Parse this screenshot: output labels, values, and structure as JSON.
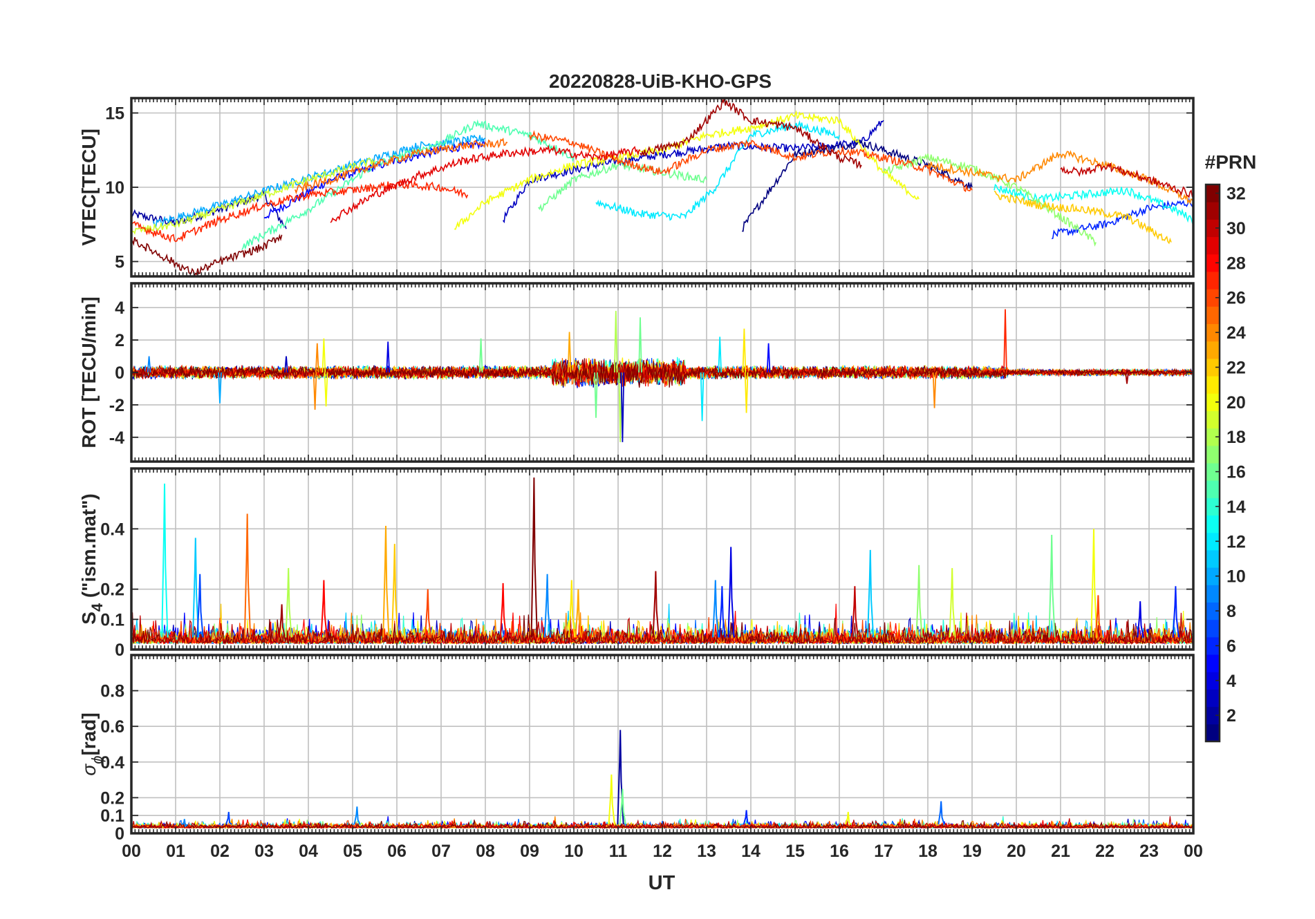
{
  "figure": {
    "title": "20220828-UiB-KHO-GPS"
  },
  "colorbar": {
    "label": "#PRN",
    "colormap": "jet",
    "range": [
      1,
      32
    ],
    "ticks": [
      "2",
      "4",
      "6",
      "8",
      "10",
      "12",
      "14",
      "16",
      "18",
      "20",
      "22",
      "24",
      "26",
      "28",
      "30",
      "32"
    ]
  },
  "colors": {
    "axis": "#262626",
    "grid": "#c0c0c0",
    "background": "#ffffff"
  },
  "chart_data": [
    {
      "type": "line",
      "panel": "vtec",
      "ylabel": "VTEC[TECU]",
      "ylabel_sub": "",
      "ylim": [
        4,
        16
      ],
      "yticks": [
        "5",
        "10",
        "15"
      ],
      "ytick_values": [
        5,
        10,
        15
      ],
      "xlim": [
        0,
        24
      ],
      "grid": true,
      "series": [
        {
          "prn": 2,
          "x": [
            0.0,
            1.0,
            2.0,
            3.0,
            3.5
          ],
          "y": [
            8.2,
            7.6,
            8.5,
            9.5,
            7.2
          ]
        },
        {
          "prn": 5,
          "x": [
            3.0,
            4.5,
            6.0,
            7.0,
            8.0
          ],
          "y": [
            8.0,
            10.5,
            11.8,
            12.5,
            13.0
          ]
        },
        {
          "prn": 3,
          "x": [
            8.4,
            9.0,
            10.5,
            12.0,
            13.5,
            15.0,
            16.5,
            17.0
          ],
          "y": [
            7.8,
            10.5,
            11.5,
            12.2,
            12.8,
            12.6,
            13.0,
            14.5
          ]
        },
        {
          "prn": 1,
          "x": [
            13.8,
            15.0,
            16.5,
            18.0,
            19.0
          ],
          "y": [
            7.2,
            12.2,
            13.0,
            11.5,
            10.0
          ]
        },
        {
          "prn": 6,
          "x": [
            20.8,
            22.0,
            23.0,
            24.0
          ],
          "y": [
            6.8,
            7.5,
            8.6,
            9.0
          ]
        },
        {
          "prn": 10,
          "x": [
            0.5,
            2.0,
            3.5,
            5.0,
            6.5,
            8.0
          ],
          "y": [
            7.5,
            8.8,
            10.2,
            11.5,
            12.8,
            13.3
          ]
        },
        {
          "prn": 12,
          "x": [
            10.5,
            11.5,
            12.5,
            13.2,
            14.0,
            15.0,
            16.0
          ],
          "y": [
            9.0,
            8.2,
            8.0,
            10.0,
            13.5,
            14.2,
            13.5
          ]
        },
        {
          "prn": 13,
          "x": [
            19.5,
            20.5,
            21.5,
            22.5,
            23.5,
            24.0
          ],
          "y": [
            10.0,
            9.2,
            9.5,
            9.8,
            8.6,
            7.8
          ]
        },
        {
          "prn": 15,
          "x": [
            2.5,
            4.0,
            5.5,
            7.0,
            7.8,
            9.0,
            10.0
          ],
          "y": [
            6.0,
            8.5,
            11.5,
            13.0,
            14.3,
            13.5,
            12.0
          ]
        },
        {
          "prn": 16,
          "x": [
            9.2,
            10.0,
            11.0,
            12.0,
            13.0
          ],
          "y": [
            8.5,
            10.5,
            11.5,
            11.0,
            10.5
          ]
        },
        {
          "prn": 17,
          "x": [
            17.0,
            18.0,
            19.0,
            20.0,
            21.0,
            21.8
          ],
          "y": [
            11.0,
            12.0,
            11.3,
            10.0,
            8.0,
            6.3
          ]
        },
        {
          "prn": 19,
          "x": [
            0.0,
            1.0,
            2.0,
            3.0,
            4.0,
            5.5
          ],
          "y": [
            7.0,
            7.5,
            8.5,
            9.5,
            10.5,
            11.8
          ]
        },
        {
          "prn": 20,
          "x": [
            7.3,
            8.0,
            9.0,
            10.0,
            11.0,
            12.0,
            13.0,
            14.0,
            15.0,
            16.0,
            17.0,
            17.8
          ],
          "y": [
            7.2,
            9.0,
            10.5,
            11.5,
            12.0,
            12.5,
            13.5,
            14.0,
            14.8,
            14.5,
            11.0,
            9.2
          ]
        },
        {
          "prn": 22,
          "x": [
            19.5,
            20.5,
            21.5,
            22.5,
            23.5
          ],
          "y": [
            9.5,
            8.8,
            8.5,
            8.0,
            6.3
          ]
        },
        {
          "prn": 24,
          "x": [
            18.0,
            19.0,
            20.0,
            21.0,
            22.0,
            23.0,
            24.0
          ],
          "y": [
            11.5,
            11.0,
            10.5,
            12.3,
            11.5,
            10.5,
            9.0
          ]
        },
        {
          "prn": 25,
          "x": [
            3.7,
            4.5,
            5.5,
            6.5,
            7.5,
            8.5
          ],
          "y": [
            9.8,
            10.5,
            11.5,
            12.3,
            12.8,
            13.0
          ]
        },
        {
          "prn": 26,
          "x": [
            9.0,
            10.0,
            11.0,
            12.0,
            13.0,
            14.0,
            15.0,
            16.0,
            17.0,
            18.0,
            19.0
          ],
          "y": [
            13.5,
            13.0,
            11.8,
            11.0,
            12.5,
            13.0,
            12.0,
            12.5,
            12.0,
            11.2,
            9.8
          ]
        },
        {
          "prn": 27,
          "x": [
            0.0,
            1.0,
            2.0,
            3.0,
            4.0,
            5.0,
            6.0,
            7.0,
            7.6
          ],
          "y": [
            7.5,
            6.5,
            7.8,
            8.8,
            9.5,
            9.8,
            10.2,
            10.0,
            9.5
          ]
        },
        {
          "prn": 29,
          "x": [
            4.5,
            5.5,
            6.5,
            7.5,
            8.5,
            9.5,
            10.5,
            11.5
          ],
          "y": [
            7.8,
            9.5,
            10.8,
            11.8,
            12.3,
            12.5,
            12.0,
            12.5
          ]
        },
        {
          "prn": 31,
          "x": [
            11.5,
            12.5,
            13.0,
            13.4,
            14.0,
            15.0,
            16.0,
            16.5
          ],
          "y": [
            12.3,
            13.0,
            14.5,
            15.8,
            14.5,
            14.0,
            12.0,
            11.5
          ]
        },
        {
          "prn": 32,
          "x": [
            0.0,
            0.8,
            1.4,
            2.0,
            3.0,
            3.4
          ],
          "y": [
            6.5,
            5.2,
            4.2,
            5.0,
            6.0,
            6.8
          ]
        },
        {
          "prn": 30,
          "x": [
            21.0,
            21.5,
            22.0,
            22.5,
            23.0,
            23.5,
            24.0
          ],
          "y": [
            11.2,
            11.0,
            11.5,
            11.0,
            10.5,
            10.0,
            9.5
          ]
        }
      ]
    },
    {
      "type": "line",
      "panel": "rot",
      "ylabel": "ROT [TECU/min]",
      "ylabel_sub": "",
      "ylim": [
        -5.5,
        5.5
      ],
      "yticks": [
        "-4",
        "-2",
        "0",
        "2",
        "4"
      ],
      "ytick_values": [
        -4,
        -2,
        0,
        2,
        4
      ],
      "xlim": [
        0,
        24
      ],
      "grid": true,
      "noise_level_TECU_per_min": 0.3,
      "spikes": [
        {
          "x": 0.4,
          "y": 1.0,
          "prn": 9
        },
        {
          "x": 2.0,
          "y": -1.9,
          "prn": 10
        },
        {
          "x": 3.5,
          "y": 1.0,
          "prn": 3
        },
        {
          "x": 4.15,
          "y": -2.3,
          "prn": 24
        },
        {
          "x": 4.2,
          "y": 1.8,
          "prn": 24
        },
        {
          "x": 4.4,
          "y": -2.1,
          "prn": 20
        },
        {
          "x": 4.35,
          "y": 2.1,
          "prn": 20
        },
        {
          "x": 5.8,
          "y": 1.9,
          "prn": 4
        },
        {
          "x": 7.9,
          "y": 2.1,
          "prn": 16
        },
        {
          "x": 9.9,
          "y": 2.5,
          "prn": 23
        },
        {
          "x": 10.5,
          "y": -2.8,
          "prn": 16
        },
        {
          "x": 10.95,
          "y": 3.8,
          "prn": 18
        },
        {
          "x": 11.05,
          "y": -4.3,
          "prn": 18
        },
        {
          "x": 11.1,
          "y": -4.3,
          "prn": 3
        },
        {
          "x": 11.5,
          "y": 3.4,
          "prn": 16
        },
        {
          "x": 13.3,
          "y": 2.2,
          "prn": 12
        },
        {
          "x": 12.9,
          "y": -3.0,
          "prn": 12
        },
        {
          "x": 13.85,
          "y": 2.7,
          "prn": 21
        },
        {
          "x": 13.9,
          "y": -2.5,
          "prn": 21
        },
        {
          "x": 14.4,
          "y": 1.8,
          "prn": 5
        },
        {
          "x": 18.15,
          "y": -2.2,
          "prn": 24
        },
        {
          "x": 19.75,
          "y": 3.9,
          "prn": 27
        },
        {
          "x": 22.5,
          "y": -0.7,
          "prn": 31
        }
      ]
    },
    {
      "type": "line",
      "panel": "s4",
      "ylabel": "S  (\"ism.mat\")",
      "ylabel_sub": "4",
      "ylim": [
        0,
        0.6
      ],
      "yticks": [
        "0",
        "0.1",
        "0.2",
        "0.4"
      ],
      "ytick_values": [
        0,
        0.1,
        0.2,
        0.4
      ],
      "xlim": [
        0,
        24
      ],
      "grid": true,
      "baseline_range": [
        0.02,
        0.08
      ],
      "spikes": [
        {
          "x": 0.75,
          "y": 0.55,
          "prn": 13
        },
        {
          "x": 1.45,
          "y": 0.37,
          "prn": 11
        },
        {
          "x": 1.55,
          "y": 0.25,
          "prn": 7
        },
        {
          "x": 2.62,
          "y": 0.45,
          "prn": 25
        },
        {
          "x": 3.4,
          "y": 0.15,
          "prn": 31
        },
        {
          "x": 3.55,
          "y": 0.27,
          "prn": 18
        },
        {
          "x": 4.35,
          "y": 0.23,
          "prn": 28
        },
        {
          "x": 5.75,
          "y": 0.41,
          "prn": 23
        },
        {
          "x": 5.95,
          "y": 0.35,
          "prn": 22
        },
        {
          "x": 6.7,
          "y": 0.2,
          "prn": 26
        },
        {
          "x": 8.4,
          "y": 0.22,
          "prn": 28
        },
        {
          "x": 9.1,
          "y": 0.57,
          "prn": 32
        },
        {
          "x": 9.4,
          "y": 0.25,
          "prn": 9
        },
        {
          "x": 9.95,
          "y": 0.23,
          "prn": 21
        },
        {
          "x": 10.1,
          "y": 0.2,
          "prn": 23
        },
        {
          "x": 11.85,
          "y": 0.26,
          "prn": 31
        },
        {
          "x": 13.2,
          "y": 0.23,
          "prn": 9
        },
        {
          "x": 13.55,
          "y": 0.34,
          "prn": 4
        },
        {
          "x": 13.35,
          "y": 0.21,
          "prn": 6
        },
        {
          "x": 16.35,
          "y": 0.21,
          "prn": 30
        },
        {
          "x": 16.7,
          "y": 0.33,
          "prn": 11
        },
        {
          "x": 17.8,
          "y": 0.28,
          "prn": 17
        },
        {
          "x": 18.55,
          "y": 0.27,
          "prn": 19
        },
        {
          "x": 20.8,
          "y": 0.38,
          "prn": 16
        },
        {
          "x": 21.75,
          "y": 0.4,
          "prn": 20
        },
        {
          "x": 21.85,
          "y": 0.18,
          "prn": 26
        },
        {
          "x": 22.8,
          "y": 0.16,
          "prn": 4
        },
        {
          "x": 23.6,
          "y": 0.21,
          "prn": 6
        }
      ]
    },
    {
      "type": "line",
      "panel": "sigma_phi",
      "ylabel": "[rad]",
      "ylabel_sub": "",
      "ylabel_symbol": "σ",
      "ylabel_symbol_sub": "ϕ",
      "ylim": [
        0,
        1.0
      ],
      "yticks": [
        "0",
        "0.1",
        "0.2",
        "0.4",
        "0.6",
        "0.8"
      ],
      "ytick_values": [
        0,
        0.1,
        0.2,
        0.4,
        0.6,
        0.8
      ],
      "xlim": [
        0,
        24
      ],
      "grid": true,
      "baseline_range": [
        0.03,
        0.06
      ],
      "spikes": [
        {
          "x": 1.2,
          "y": 0.08,
          "prn": 9
        },
        {
          "x": 2.2,
          "y": 0.12,
          "prn": 7
        },
        {
          "x": 5.1,
          "y": 0.15,
          "prn": 9
        },
        {
          "x": 10.85,
          "y": 0.33,
          "prn": 20
        },
        {
          "x": 11.05,
          "y": 0.58,
          "prn": 2
        },
        {
          "x": 11.1,
          "y": 0.25,
          "prn": 16
        },
        {
          "x": 13.9,
          "y": 0.13,
          "prn": 6
        },
        {
          "x": 16.2,
          "y": 0.12,
          "prn": 20
        },
        {
          "x": 18.3,
          "y": 0.18,
          "prn": 8
        }
      ]
    }
  ],
  "xaxis": {
    "label": "UT",
    "ticks": [
      "00",
      "01",
      "02",
      "03",
      "04",
      "05",
      "06",
      "07",
      "08",
      "09",
      "10",
      "11",
      "12",
      "13",
      "14",
      "15",
      "16",
      "17",
      "18",
      "19",
      "20",
      "21",
      "22",
      "23",
      "00"
    ]
  }
}
